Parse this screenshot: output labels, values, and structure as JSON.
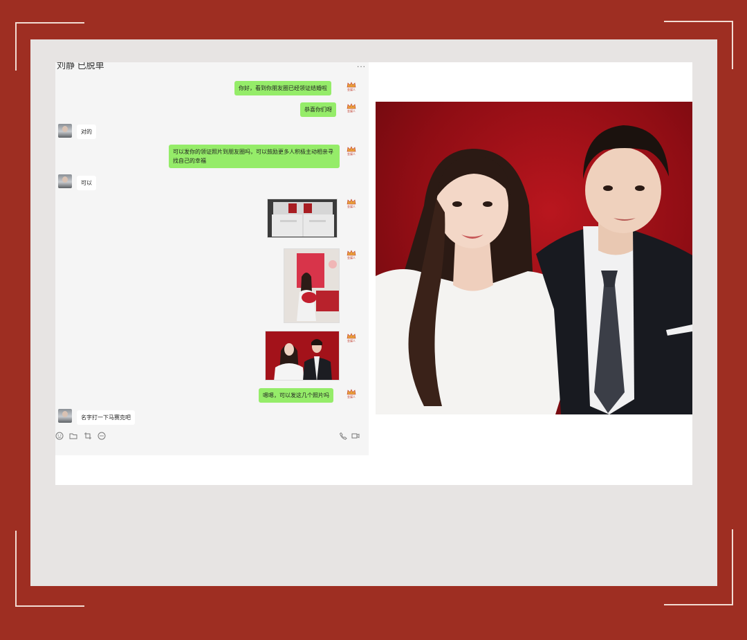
{
  "header": {
    "contact_name": "刘静  已脱单",
    "more_label": "..."
  },
  "self_avatar": {
    "icon": "crown-logo-icon",
    "logo_text": "金媒人"
  },
  "messages": [
    {
      "side": "out",
      "type": "text",
      "text": "你好，看到你朋友圈已经领证结婚啦"
    },
    {
      "side": "out",
      "type": "text",
      "text": "恭喜你们呀"
    },
    {
      "side": "in",
      "type": "text",
      "text": "对的"
    },
    {
      "side": "out",
      "type": "text",
      "text": "可以发你的领证照片到朋友圈吗，可以鼓励更多人积极主动相亲寻找自己的幸福"
    },
    {
      "side": "in",
      "type": "text",
      "text": "可以"
    },
    {
      "side": "out",
      "type": "image",
      "alt": "marriage-certificate-photo"
    },
    {
      "side": "out",
      "type": "image",
      "alt": "bride-with-flowers-photo"
    },
    {
      "side": "out",
      "type": "image",
      "alt": "couple-wedding-photo"
    },
    {
      "side": "out",
      "type": "text",
      "text": "嗯嗯，可以发这几个照片吗"
    },
    {
      "side": "in",
      "type": "text",
      "text": "名字打一下马赛克吧"
    }
  ],
  "toolbar": {
    "icons": [
      "emoji-icon",
      "folder-icon",
      "screenshot-icon",
      "chat-history-icon",
      "phone-icon",
      "video-icon"
    ]
  },
  "colors": {
    "frame": "#9e2e22",
    "bubble_out": "#95ec69",
    "bubble_in": "#ffffff",
    "photo_bg": "#a3121a"
  }
}
